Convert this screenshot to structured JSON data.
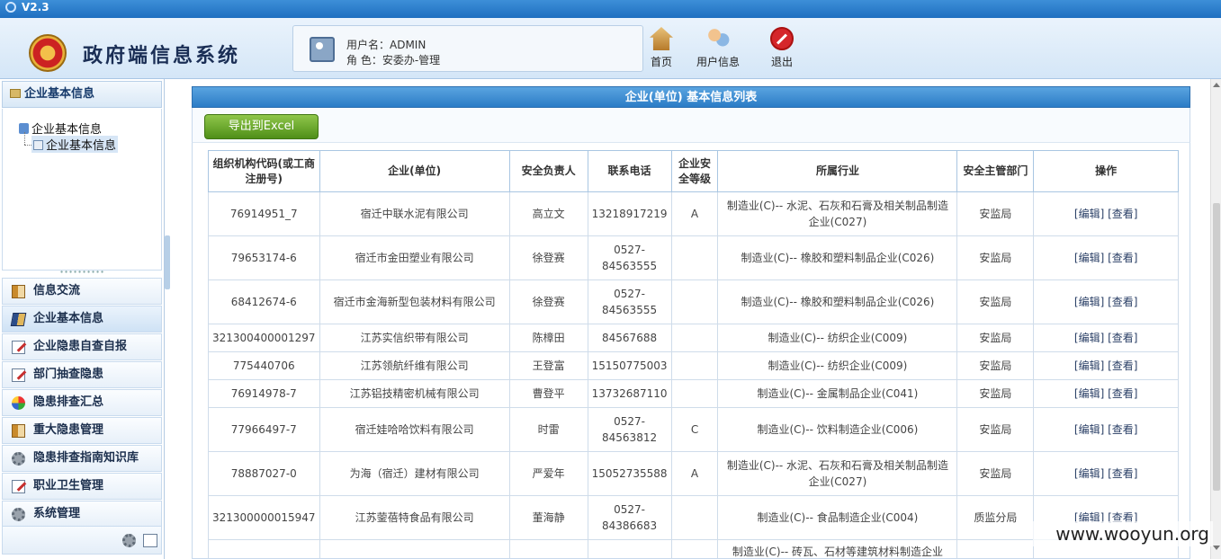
{
  "titlebar": {
    "version": "V2.3"
  },
  "header": {
    "app_title": "政府端信息系统",
    "username_line": "用户名：ADMIN",
    "role_line": "角 色：安委办-管理"
  },
  "nav": {
    "home": "首页",
    "user_info": "用户信息",
    "exit": "退出"
  },
  "sidebar": {
    "section_title": "企业基本信息",
    "tree": {
      "root": "企业基本信息",
      "child": "企业基本信息"
    },
    "splitter": "∙∙∙∙∙∙∙∙∙∙",
    "menu": [
      {
        "label": "信息交流",
        "icon": "book-icon"
      },
      {
        "label": "企业基本信息",
        "icon": "books-icon"
      },
      {
        "label": "企业隐患自查自报",
        "icon": "edit-icon"
      },
      {
        "label": "部门抽查隐患",
        "icon": "edit-icon"
      },
      {
        "label": "隐患排查汇总",
        "icon": "pie-chart-icon"
      },
      {
        "label": "重大隐患管理",
        "icon": "book-icon"
      },
      {
        "label": "隐患排查指南知识库",
        "icon": "gear-icon"
      },
      {
        "label": "职业卫生管理",
        "icon": "edit-icon"
      },
      {
        "label": "系统管理",
        "icon": "gear-icon"
      }
    ]
  },
  "main": {
    "panel_title": "企业(单位) 基本信息列表",
    "export_button": "导出到Excel",
    "columns": [
      "组织机构代码(或工商注册号)",
      "企业(单位)",
      "安全负责人",
      "联系电话",
      "企业安全等级",
      "所属行业",
      "安全主管部门",
      "操作"
    ],
    "rows": [
      {
        "code": "76914951_7",
        "name": "宿迁中联水泥有限公司",
        "person": "高立文",
        "phone": "13218917219",
        "level": "A",
        "industry": "制造业(C)-- 水泥、石灰和石膏及相关制品制造企业(C027)",
        "dept": "安监局",
        "op": "[编辑] [查看]"
      },
      {
        "code": "79653174-6",
        "name": "宿迁市金田塑业有限公司",
        "person": "徐登赛",
        "phone": "0527-84563555",
        "level": "",
        "industry": "制造业(C)-- 橡胶和塑料制品企业(C026)",
        "dept": "安监局",
        "op": "[编辑] [查看]"
      },
      {
        "code": "68412674-6",
        "name": "宿迁市金海新型包装材料有限公司",
        "person": "徐登赛",
        "phone": "0527-84563555",
        "level": "",
        "industry": "制造业(C)-- 橡胶和塑料制品企业(C026)",
        "dept": "安监局",
        "op": "[编辑] [查看]"
      },
      {
        "code": "321300400001297",
        "name": "江苏实信织带有限公司",
        "person": "陈樟田",
        "phone": "84567688",
        "level": "",
        "industry": "制造业(C)-- 纺织企业(C009)",
        "dept": "安监局",
        "op": "[编辑] [查看]"
      },
      {
        "code": "775440706",
        "name": "江苏领航纤维有限公司",
        "person": "王登富",
        "phone": "15150775003",
        "level": "",
        "industry": "制造业(C)-- 纺织企业(C009)",
        "dept": "安监局",
        "op": "[编辑] [查看]"
      },
      {
        "code": "76914978-7",
        "name": "江苏铝技精密机械有限公司",
        "person": "曹登平",
        "phone": "13732687110",
        "level": "",
        "industry": "制造业(C)-- 金属制品企业(C041)",
        "dept": "安监局",
        "op": "[编辑] [查看]"
      },
      {
        "code": "77966497-7",
        "name": "宿迁娃哈哈饮料有限公司",
        "person": "时雷",
        "phone": "0527-84563812",
        "level": "C",
        "industry": "制造业(C)-- 饮料制造企业(C006)",
        "dept": "安监局",
        "op": "[编辑] [查看]"
      },
      {
        "code": "78887027-0",
        "name": "为海（宿迁）建材有限公司",
        "person": "严爱年",
        "phone": "15052735588",
        "level": "A",
        "industry": "制造业(C)-- 水泥、石灰和石膏及相关制品制造企业(C027)",
        "dept": "安监局",
        "op": "[编辑] [查看]"
      },
      {
        "code": "321300000015947",
        "name": "江苏蓥蓓特食品有限公司",
        "person": "董海静",
        "phone": "0527-84386683",
        "level": "",
        "industry": "制造业(C)-- 食品制造企业(C004)",
        "dept": "质监分局",
        "op": "[编辑] [查看]"
      },
      {
        "code": "",
        "name": "",
        "person": "",
        "phone": "",
        "level": "",
        "industry": "制造业(C)-- 砖瓦、石材等建筑材料制造企业",
        "dept": "",
        "op": ""
      }
    ]
  },
  "watermark": "www.wooyun.org"
}
